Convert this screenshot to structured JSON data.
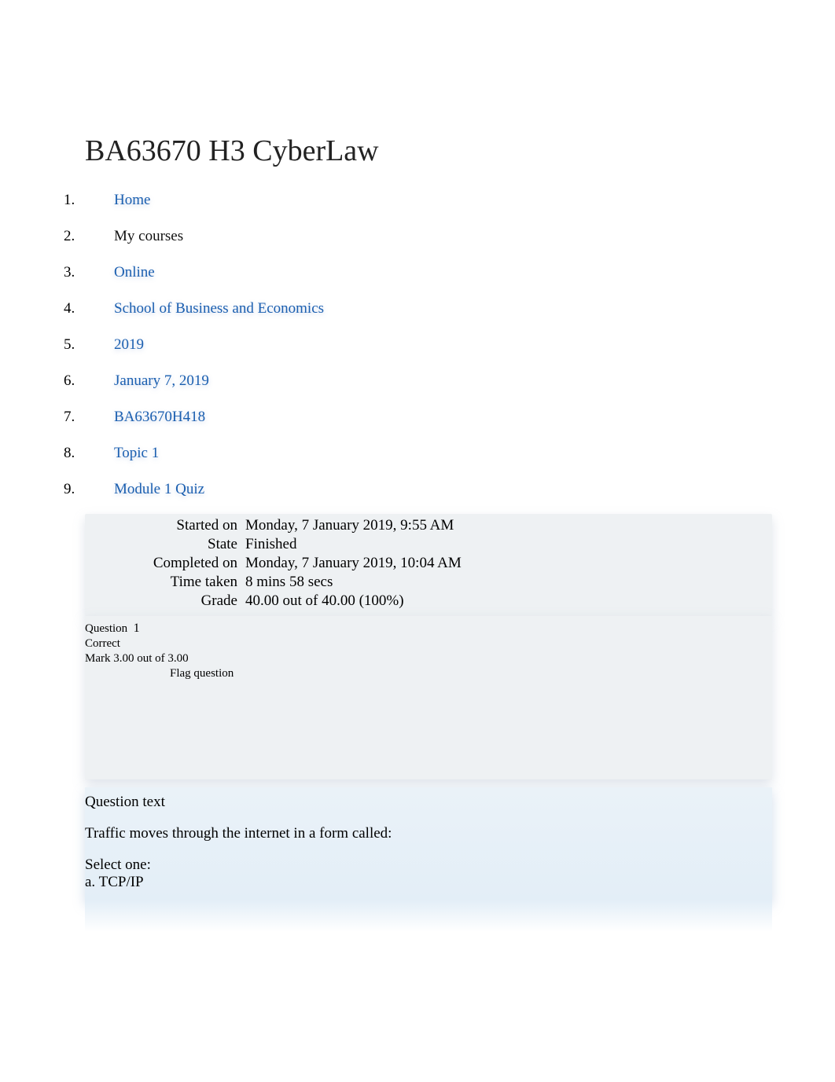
{
  "title": "BA63670 H3 CyberLaw",
  "breadcrumb": [
    {
      "label": "Home",
      "link": true
    },
    {
      "label": "My courses",
      "link": false
    },
    {
      "label": "Online",
      "link": true
    },
    {
      "label": "School of Business and Economics",
      "link": true
    },
    {
      "label": "2019",
      "link": true
    },
    {
      "label": "January 7, 2019",
      "link": true
    },
    {
      "label": "BA63670H418",
      "link": true
    },
    {
      "label": "Topic 1",
      "link": true
    },
    {
      "label": "Module 1 Quiz",
      "link": true
    }
  ],
  "summary": {
    "started_on_label": "Started on",
    "started_on_value": "Monday, 7 January 2019, 9:55 AM",
    "state_label": "State",
    "state_value": "Finished",
    "completed_on_label": "Completed on",
    "completed_on_value": "Monday, 7 January 2019, 10:04 AM",
    "time_taken_label": "Time taken",
    "time_taken_value": "8 mins 58 secs",
    "grade_label": "Grade",
    "grade_value": "40.00 out of 40.00 (100%)"
  },
  "question": {
    "label": "Question",
    "number": "1",
    "status": "Correct",
    "mark": "Mark 3.00 out of 3.00",
    "flag": "Flag question",
    "text_heading": "Question text",
    "text": "Traffic moves through the internet in a form called:",
    "select_one": "Select one:",
    "option_a_prefix": "a.",
    "option_a": "TCP/IP"
  }
}
